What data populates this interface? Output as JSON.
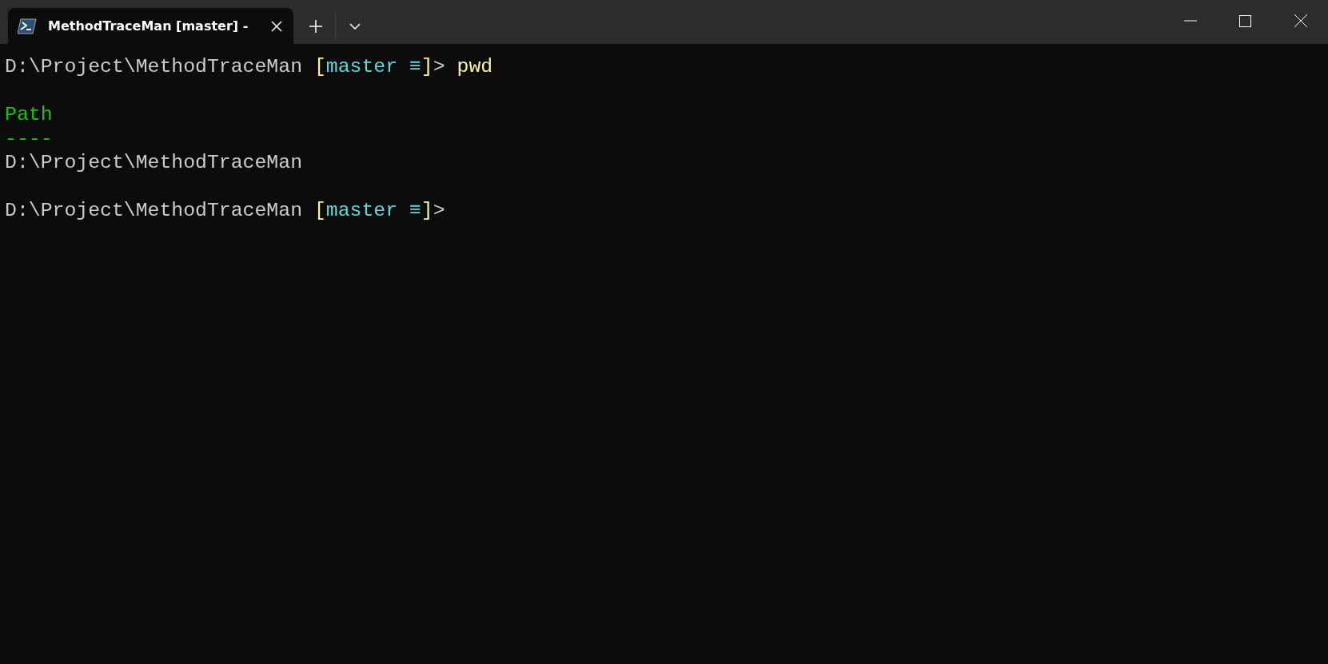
{
  "tabs": [
    {
      "title": "MethodTraceMan [master] -",
      "selected": true
    }
  ],
  "terminal": {
    "blocks": [
      {
        "lines": [
          {
            "segments": [
              {
                "kind": "path",
                "text": "D:\\Project\\MethodTraceMan "
              },
              {
                "kind": "bracket",
                "text": "["
              },
              {
                "kind": "branch",
                "text": "master ≡"
              },
              {
                "kind": "bracket",
                "text": "]"
              },
              {
                "kind": "prompt",
                "text": "> "
              },
              {
                "kind": "command",
                "text": "pwd"
              }
            ]
          }
        ]
      },
      {
        "lines": [
          {
            "segments": [
              {
                "kind": "header",
                "text": "Path"
              }
            ]
          },
          {
            "segments": [
              {
                "kind": "header",
                "text": "----"
              }
            ]
          },
          {
            "segments": [
              {
                "kind": "output",
                "text": "D:\\Project\\MethodTraceMan"
              }
            ]
          }
        ]
      },
      {
        "lines": [
          {
            "segments": [
              {
                "kind": "path",
                "text": "D:\\Project\\MethodTraceMan "
              },
              {
                "kind": "bracket",
                "text": "["
              },
              {
                "kind": "branch",
                "text": "master ≡"
              },
              {
                "kind": "bracket",
                "text": "]"
              },
              {
                "kind": "prompt",
                "text": ">"
              }
            ]
          }
        ]
      }
    ]
  }
}
